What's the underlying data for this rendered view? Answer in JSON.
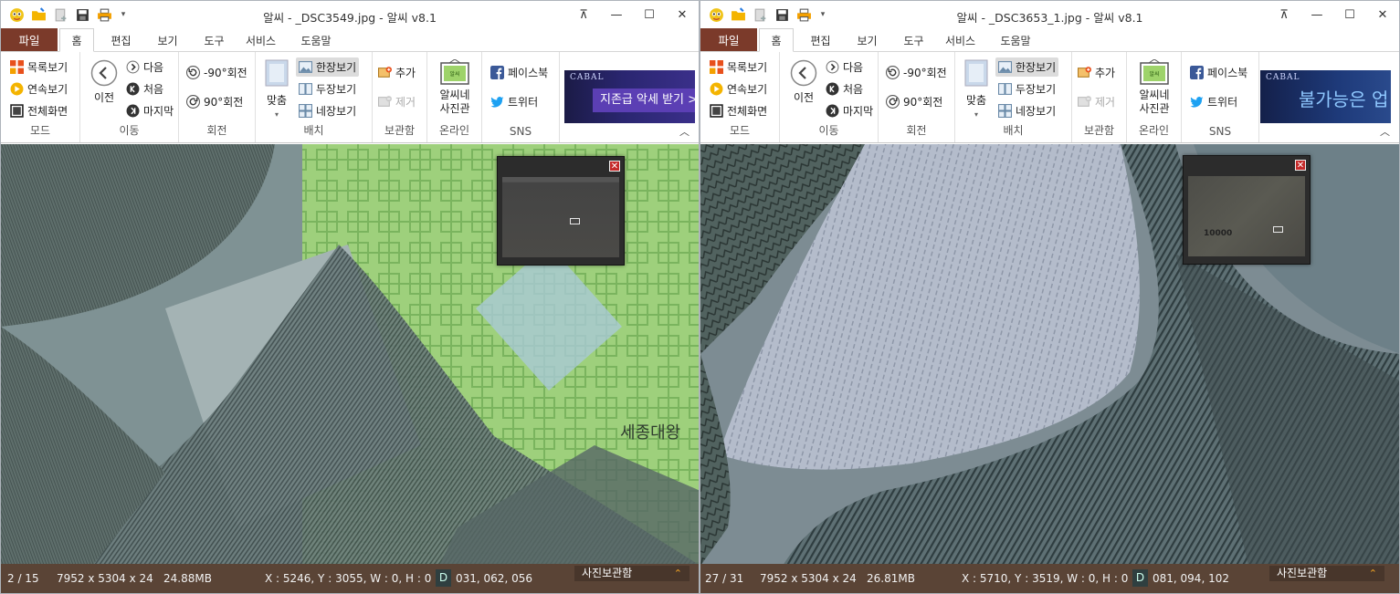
{
  "left": {
    "title": "알씨 - _DSC3549.jpg - 알씨 v8.1",
    "tabs": {
      "file": "파일",
      "home": "홈",
      "edit": "편집",
      "view": "보기",
      "tool": "도구",
      "service": "서비스",
      "help": "도움말"
    },
    "ribbon": {
      "mode": {
        "list": "목록보기",
        "continuous": "연속보기",
        "fullscreen": "전체화면",
        "label": "모드"
      },
      "move": {
        "prev": "이전",
        "next": "다음",
        "first": "처음",
        "last": "마지막",
        "label": "이동"
      },
      "rotate": {
        "ccw": "-90°회전",
        "cw": "90°회전",
        "label": "회전"
      },
      "layout": {
        "fit": "맞춤",
        "single": "한장보기",
        "double": "두장보기",
        "quad": "네장보기",
        "label": "배치"
      },
      "album": {
        "add": "추가",
        "remove": "제거",
        "label": "보관함"
      },
      "online": {
        "line1": "알씨네",
        "line2": "사진관",
        "label": "온라인"
      },
      "sns": {
        "facebook": "페이스북",
        "twitter": "트위터",
        "label": "SNS"
      },
      "ad": {
        "brand": "CABAL",
        "text": "지존급 악세 받기 >"
      }
    },
    "image_caption": "세종대왕",
    "status": {
      "index": "2 / 15",
      "dims": "7952 x 5304 x 24",
      "size": "24.88MB",
      "coords": "X : 5246, Y : 3055, W : 0, H : 0",
      "badge": "D",
      "rgb": "031, 062, 056",
      "album": "사진보관함"
    }
  },
  "right": {
    "title": "알씨 - _DSC3653_1.jpg - 알씨 v8.1",
    "tabs": {
      "file": "파일",
      "home": "홈",
      "edit": "편집",
      "view": "보기",
      "tool": "도구",
      "service": "서비스",
      "help": "도움말"
    },
    "ribbon": {
      "mode": {
        "list": "목록보기",
        "continuous": "연속보기",
        "fullscreen": "전체화면",
        "label": "모드"
      },
      "move": {
        "prev": "이전",
        "next": "다음",
        "first": "처음",
        "last": "마지막",
        "label": "이동"
      },
      "rotate": {
        "ccw": "-90°회전",
        "cw": "90°회전",
        "label": "회전"
      },
      "layout": {
        "fit": "맞춤",
        "single": "한장보기",
        "double": "두장보기",
        "quad": "네장보기",
        "label": "배치"
      },
      "album": {
        "add": "추가",
        "remove": "제거",
        "label": "보관함"
      },
      "online": {
        "line1": "알씨네",
        "line2": "사진관",
        "label": "온라인"
      },
      "sns": {
        "facebook": "페이스북",
        "twitter": "트위터",
        "label": "SNS"
      },
      "ad": {
        "brand": "CABAL",
        "text": "불가능은 업"
      }
    },
    "navigator_caption": "10000",
    "status": {
      "index": "27 / 31",
      "dims": "7952 x 5304 x 24",
      "size": "26.81MB",
      "coords": "X : 5710, Y : 3519, W : 0, H : 0",
      "badge": "D",
      "rgb": "081, 094, 102",
      "album": "사진보관함"
    }
  },
  "colors": {
    "file_tab": "#7b3a2a",
    "status_bar": "#5a4436",
    "accent": "#f5a623",
    "close_red": "#c52a2a"
  }
}
